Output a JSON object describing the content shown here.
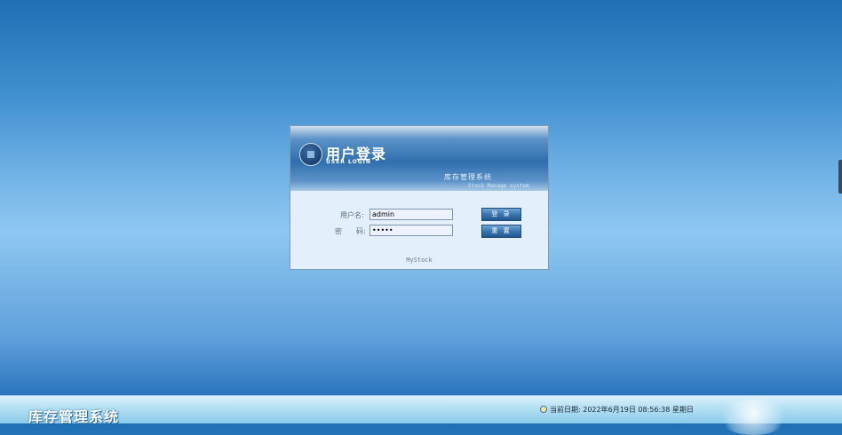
{
  "dialog": {
    "title_cn": "用户登录",
    "title_en": "USER LOGIN",
    "system_cn": "库存管理系统",
    "system_en": "Stock Manage system",
    "username_label": "用户名:",
    "password_label": "密　　码:",
    "username_value": "admin",
    "password_value": "•••••",
    "login_button": "登 录",
    "reset_button": "重 置",
    "footer_text": "MyStock"
  },
  "bottombar": {
    "app_title": "库存管理系统",
    "date_label": "当前日期:",
    "date_value": "2022年6月19日 08:56:38 星期日"
  },
  "colors": {
    "background_top": "#1f6fb4",
    "background_mid": "#8ec7f0",
    "dialog_header": "#2f6fad",
    "dialog_body": "#e3effa",
    "button": "#3a75b0"
  },
  "icons": [
    "logo-circle-icon",
    "clock-icon",
    "globe-icon"
  ]
}
